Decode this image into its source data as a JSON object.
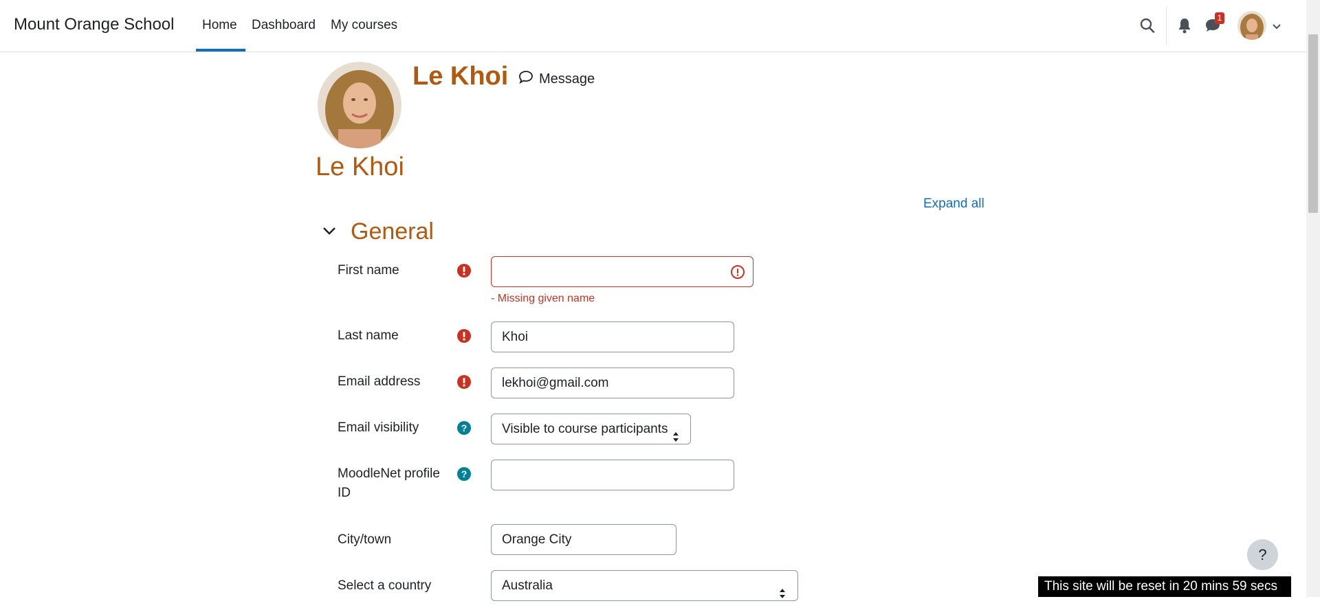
{
  "navbar": {
    "brand": "Mount Orange School",
    "links": [
      {
        "label": "Home",
        "active": true
      },
      {
        "label": "Dashboard"
      },
      {
        "label": "My courses"
      }
    ],
    "messages_badge": "1",
    "icons": [
      "search-icon",
      "bell-icon",
      "chat-icon",
      "chevron-down-icon"
    ]
  },
  "header": {
    "name": "Le Khoi",
    "message_label": "Message"
  },
  "page_title": "Le Khoi",
  "expand_all": "Expand all",
  "section": {
    "title": "General",
    "fields": {
      "first_name": {
        "label": "First name",
        "value": "",
        "error": "- Missing given name",
        "required": true
      },
      "last_name": {
        "label": "Last name",
        "value": "Khoi",
        "required": true
      },
      "email": {
        "label": "Email address",
        "value": "lekhoi@gmail.com",
        "required": true
      },
      "email_visibility": {
        "label": "Email visibility",
        "value": "Visible to course participants"
      },
      "moodlenet": {
        "label_line1": "MoodleNet profile",
        "label_line2": "ID",
        "value": ""
      },
      "city": {
        "label": "City/town",
        "value": "Orange City"
      },
      "country": {
        "label": "Select a country",
        "value": "Australia"
      }
    }
  },
  "help_button": "?",
  "reset_banner": "This site will be reset in 20 mins 59 secs",
  "colors": {
    "accent": "#0f6cbf",
    "heading": "#b2590f",
    "error": "#ca3120",
    "help": "#008196"
  }
}
